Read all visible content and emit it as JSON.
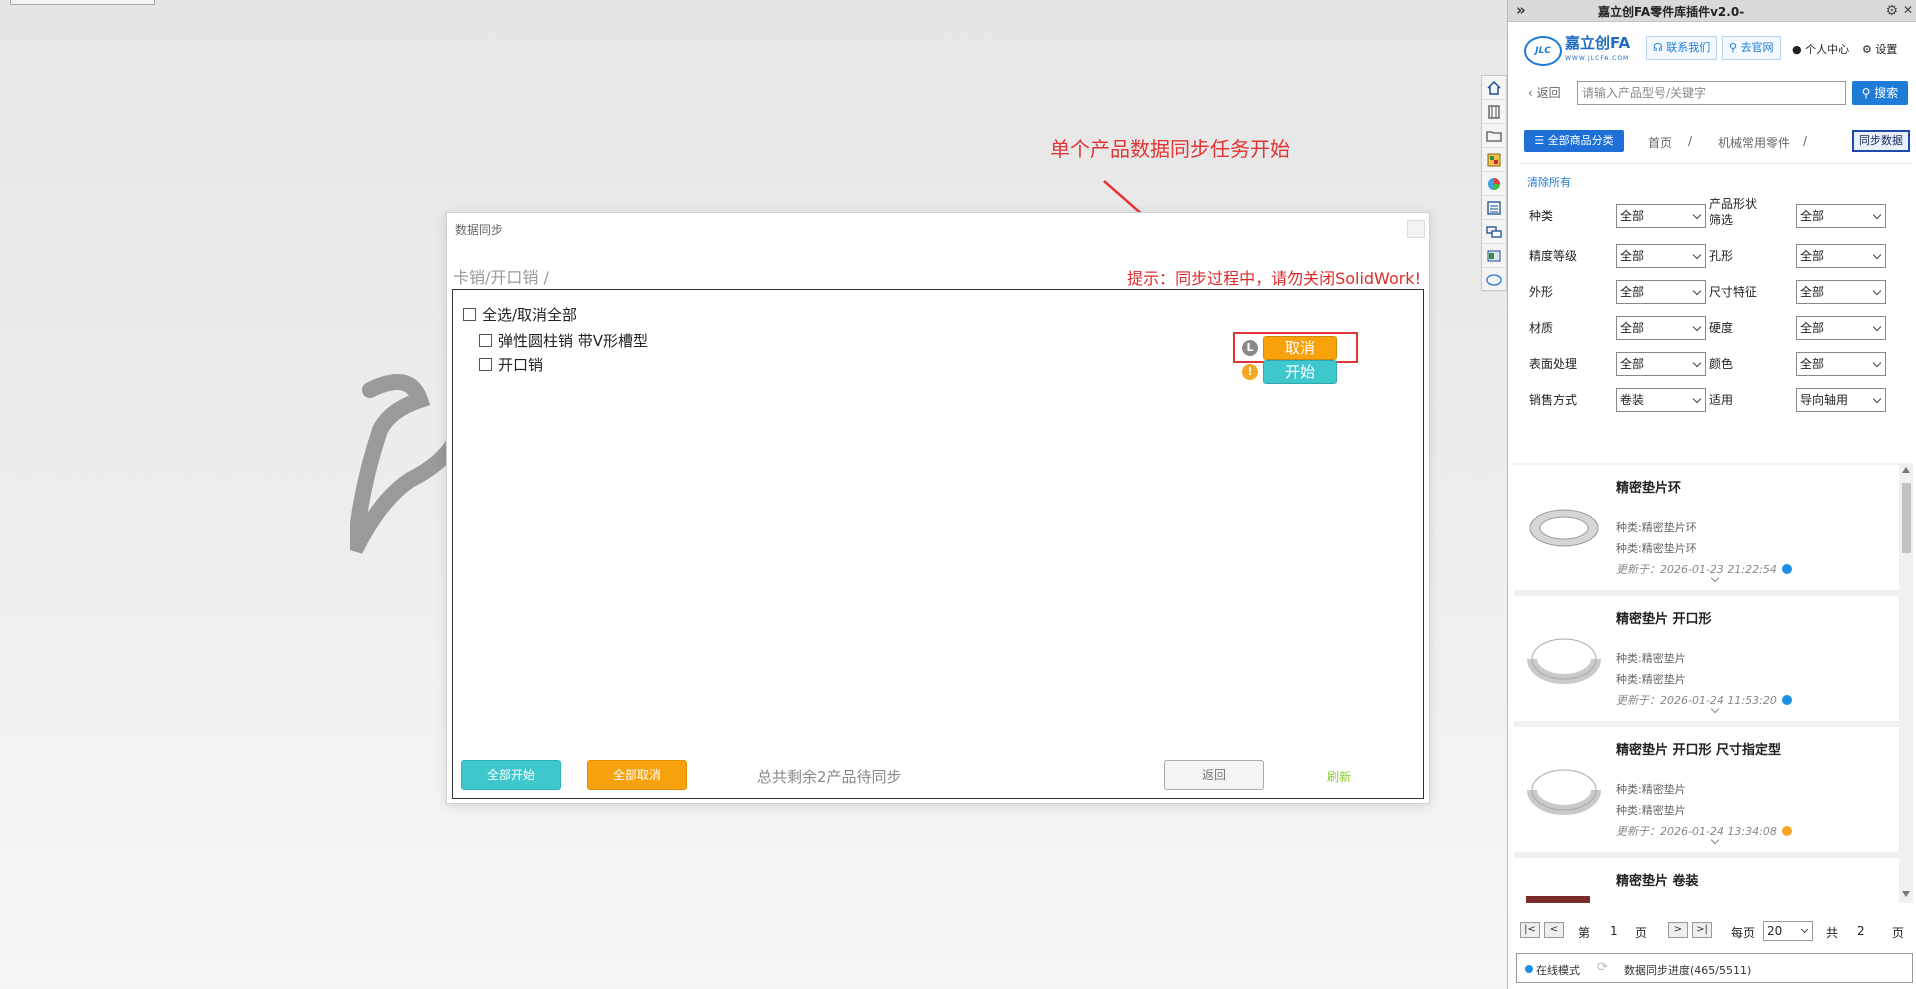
{
  "annotation": {
    "text": "单个产品数据同步任务开始"
  },
  "dialog": {
    "title": "数据同步",
    "breadcrumb": "卡销/开口销 /",
    "warning": "提示：同步过程中，请勿关闭SolidWork!",
    "select_all_label": "全选/取消全部",
    "items": [
      {
        "name": "弹性圆柱销 带V形槽型",
        "status_icon": "clock-icon",
        "action_label": "取消",
        "action_color": "#f7a10d"
      },
      {
        "name": "开口销",
        "status_icon": "warning-icon",
        "action_label": "开始",
        "action_color": "#3ec7cc"
      }
    ],
    "footer": {
      "start_all_label": "全部开始",
      "cancel_all_label": "全部取消",
      "remaining_text": "总共剩余2产品待同步",
      "back_label": "返回",
      "refresh_label": "刷新"
    }
  },
  "toolbar_icons": [
    "home-icon",
    "parts-icon",
    "folder-icon",
    "palette-icon",
    "color-wheel-icon",
    "list-icon",
    "chat-icon",
    "preview-icon",
    "jlc-logo-icon"
  ],
  "panel": {
    "title": "嘉立创FA零件库插件v2.0-",
    "logo": {
      "mark": "JLC",
      "name": "嘉立创FA",
      "sub": "WWW.JLCFA.COM"
    },
    "header": {
      "contact_label": "联系我们",
      "website_label": "去官网",
      "user_label": "个人中心",
      "settings_label": "设置"
    },
    "back_label": "返回",
    "search": {
      "placeholder": "请输入产品型号/关键字",
      "button_label": "搜索"
    },
    "category_button": "全部商品分类",
    "breadcrumb": [
      "首页",
      "/",
      "机械常用零件",
      "/"
    ],
    "sync_button": "同步数据",
    "clear_all": "清除所有",
    "filters": [
      {
        "label": "种类",
        "value": "全部"
      },
      {
        "label": "产品形状筛选",
        "value": "全部"
      },
      {
        "label": "精度等级",
        "value": "全部"
      },
      {
        "label": "孔形",
        "value": "全部"
      },
      {
        "label": "外形",
        "value": "全部"
      },
      {
        "label": "尺寸特征",
        "value": "全部"
      },
      {
        "label": "材质",
        "value": "全部"
      },
      {
        "label": "硬度",
        "value": "全部"
      },
      {
        "label": "表面处理",
        "value": "全部"
      },
      {
        "label": "颜色",
        "value": "全部"
      },
      {
        "label": "销售方式",
        "value": "卷装"
      },
      {
        "label": "适用",
        "value": "导向轴用"
      }
    ],
    "products": [
      {
        "name": "精密垫片环",
        "line1": "种类:精密垫片环",
        "line2": "种类:精密垫片环",
        "updated": "更新于：2026-01-23 21:22:54",
        "status": "ok"
      },
      {
        "name": "精密垫片 开口形",
        "line1": "种类:精密垫片",
        "line2": "种类:精密垫片",
        "updated": "更新于：2026-01-24 11:53:20",
        "status": "ok"
      },
      {
        "name": "精密垫片 开口形 尺寸指定型",
        "line1": "种类:精密垫片",
        "line2": "种类:精密垫片",
        "updated": "更新于：2026-01-24 13:34:08",
        "status": "warn"
      },
      {
        "name": "精密垫片 卷装",
        "line1": "",
        "line2": "",
        "updated": "",
        "status": ""
      }
    ],
    "pager": {
      "first": "|<",
      "prev": "<",
      "next": ">",
      "last": ">|",
      "page_prefix": "第",
      "page": "1",
      "page_suffix": "页",
      "per_page_label": "每页",
      "per_page": "20",
      "total_prefix": "共",
      "total_pages": "2",
      "total_suffix": "页"
    },
    "status": {
      "mode": "在线模式",
      "progress": "数据同步进度(465/5511)"
    }
  }
}
